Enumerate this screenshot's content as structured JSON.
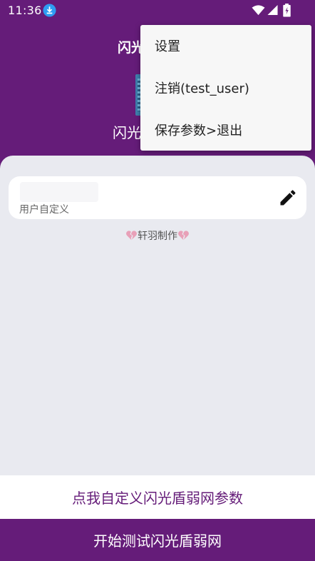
{
  "status_bar": {
    "time": "11:36",
    "icons": [
      "download-icon",
      "wifi-icon",
      "signal-icon",
      "battery-icon"
    ]
  },
  "header": {
    "title": "闪光",
    "subtitle": "闪光"
  },
  "card": {
    "hint": "用户自定义",
    "edit_icon": "pencil-icon"
  },
  "credit": {
    "text": "轩羽制作",
    "icon": "broken-heart-icon"
  },
  "buttons": {
    "custom_params": "点我自定义闪光盾弱网参数",
    "start_test": "开始测试闪光盾弱网"
  },
  "menu": {
    "items": [
      {
        "label": "设置"
      },
      {
        "label": "注销(test_user)"
      },
      {
        "label": "保存参数>退出"
      }
    ]
  },
  "colors": {
    "primary": "#651c79",
    "background": "#e9eaf0",
    "menu_bg": "#f7f7f7",
    "heart": "#e8a0b8"
  }
}
